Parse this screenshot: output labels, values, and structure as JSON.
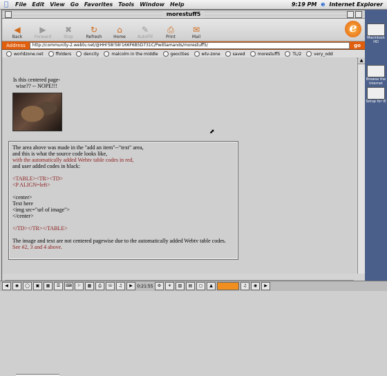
{
  "menubar": {
    "items": [
      "File",
      "Edit",
      "View",
      "Go",
      "Favorites",
      "Tools",
      "Window",
      "Help"
    ],
    "clock": "9:19 PM",
    "app": "Internet Explorer"
  },
  "window": {
    "title": "morestuff5"
  },
  "toolbar": {
    "buttons": [
      {
        "label": "Back",
        "icon": "back-arrow-icon"
      },
      {
        "label": "Forward",
        "icon": "forward-arrow-icon"
      },
      {
        "label": "Stop",
        "icon": "stop-icon"
      },
      {
        "label": "Refresh",
        "icon": "refresh-icon"
      },
      {
        "label": "Home",
        "icon": "home-icon"
      },
      {
        "label": "AutoFill",
        "icon": "autofill-icon"
      },
      {
        "label": "Print",
        "icon": "print-icon"
      },
      {
        "label": "Mail",
        "icon": "mail-icon"
      }
    ]
  },
  "address": {
    "label": "Address",
    "url": "http://community-2.webtv.net/@HH!58!58!166F6B5D731C/Pwilliamands/morestuff5/",
    "go": "go"
  },
  "favorites": [
    "worldzone.net",
    "ffolders",
    "dencity",
    "malcolm in the middle",
    "geocities",
    "wtv-zone",
    "saved",
    "morestuff5",
    "TL/2",
    "very_odd"
  ],
  "page": {
    "caption": "Is this centered page-wise?? -- NOPE!!!",
    "box": {
      "intro1": "The area above was made in the \"add an item\"--\"text\" area,",
      "intro2": "and this is what the source code looks like,",
      "intro3": "with the automatically added Webtv table codes in red,",
      "intro4": "and user added codes in black:",
      "code_red1": "<TABLE><TR><TD>",
      "code_red2": "<P ALIGN=left>",
      "code_b1": "<center>",
      "code_b2": "Text here",
      "code_b3": "<img src=\"url of image\">",
      "code_b4": "</center>",
      "code_red3": "</TD></TR></TABLE>",
      "outro": "The image and text are not centered pagewise due to the automatically added Webtv table codes.",
      "outro_red": "See #2, 3 and 4 above."
    }
  },
  "desktop": {
    "labels": [
      "Macintosh HD",
      "Browse the Internet",
      "Setup for IE"
    ]
  },
  "controlstrip": {
    "clock": "0:21:55"
  }
}
